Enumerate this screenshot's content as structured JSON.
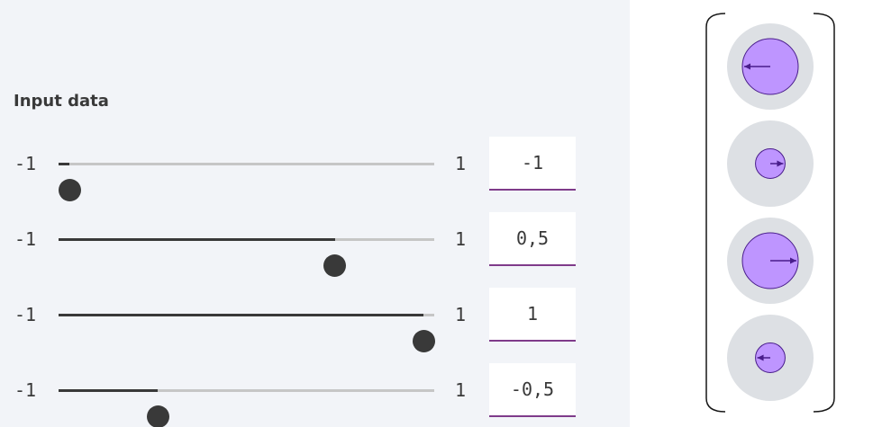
{
  "input_panel": {
    "title": "Input data",
    "sliders": [
      {
        "min_label": "-1",
        "max_label": "1",
        "value": -1,
        "value_text": "-1"
      },
      {
        "min_label": "-1",
        "max_label": "1",
        "value": 0.5,
        "value_text": "0,5"
      },
      {
        "min_label": "-1",
        "max_label": "1",
        "value": 1,
        "value_text": "1"
      },
      {
        "min_label": "-1",
        "max_label": "1",
        "value": -0.5,
        "value_text": "-0,5"
      }
    ]
  },
  "vector_display": {
    "colors": {
      "outer_disc": "#dde0e4",
      "inner_disc": "#be95ff",
      "inner_stroke": "#491d8b",
      "arrow": "#491d8b",
      "bracket": "#161616"
    },
    "entries": [
      {
        "magnitude": 1,
        "direction": "left"
      },
      {
        "magnitude": 0.5,
        "direction": "right"
      },
      {
        "magnitude": 1,
        "direction": "right"
      },
      {
        "magnitude": 0.5,
        "direction": "left"
      }
    ]
  },
  "colors": {
    "panel_bg": "#f2f4f8",
    "track_empty": "#c6c6c6",
    "track_filled": "#393939",
    "thumb": "#393939",
    "field_underline": "#7f3b8a",
    "text": "#393939"
  }
}
